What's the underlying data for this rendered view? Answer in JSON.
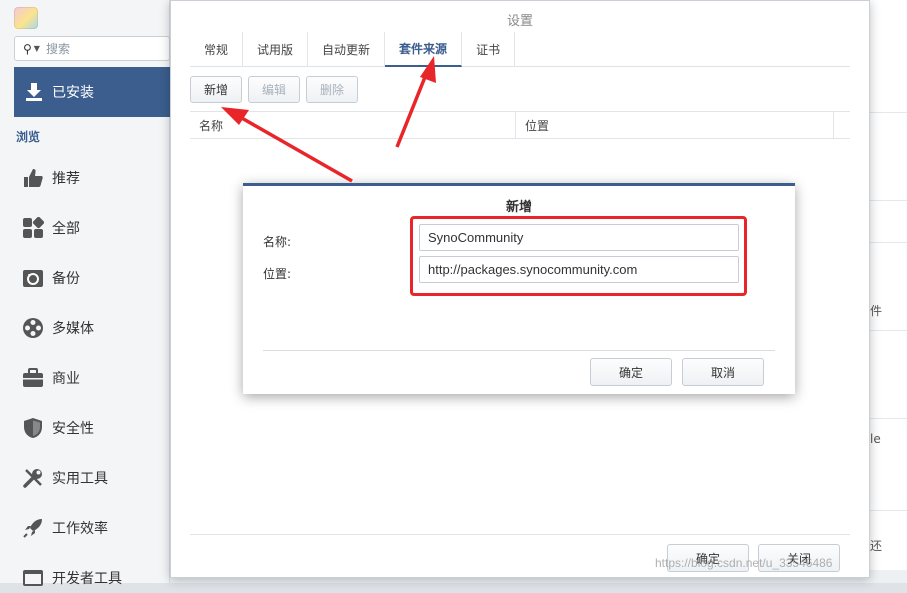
{
  "sidebar": {
    "search_placeholder": "搜索",
    "installed_label": "已安装",
    "browse_label": "浏览",
    "items": [
      {
        "label": "推荐",
        "icon": "thumbs-up-icon"
      },
      {
        "label": "全部",
        "icon": "grid-icon"
      },
      {
        "label": "备份",
        "icon": "backup-icon"
      },
      {
        "label": "多媒体",
        "icon": "film-reel-icon"
      },
      {
        "label": "商业",
        "icon": "briefcase-icon"
      },
      {
        "label": "安全性",
        "icon": "shield-icon"
      },
      {
        "label": "实用工具",
        "icon": "tools-icon"
      },
      {
        "label": "工作效率",
        "icon": "rocket-icon"
      },
      {
        "label": "开发者工具",
        "icon": "developer-icon"
      }
    ]
  },
  "settings": {
    "title": "设置",
    "tabs": [
      {
        "label": "常规",
        "active": false
      },
      {
        "label": "试用版",
        "active": false
      },
      {
        "label": "自动更新",
        "active": false
      },
      {
        "label": "套件来源",
        "active": true
      },
      {
        "label": "证书",
        "active": false
      }
    ],
    "toolbar": {
      "add": "新增",
      "edit": "编辑",
      "delete": "删除"
    },
    "columns": {
      "name": "名称",
      "location": "位置"
    },
    "ok": "确定",
    "close": "关闭"
  },
  "dialog": {
    "title": "新增",
    "name_label": "名称:",
    "name_value": "SynoCommunity",
    "location_label": "位置:",
    "location_value": "http://packages.synocommunity.com",
    "ok": "确定",
    "cancel": "取消"
  },
  "background": {
    "right_fragments": [
      "件",
      "le",
      "还"
    ]
  },
  "watermark": "https://blog.csdn.net/u_33546486",
  "colors": {
    "accent": "#3b5e8e",
    "annotation_red": "#e8262a"
  }
}
